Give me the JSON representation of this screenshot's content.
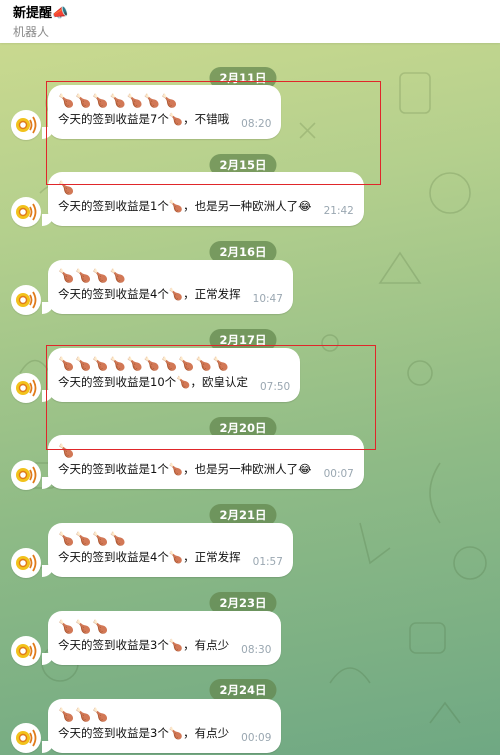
{
  "header": {
    "title": "新提醒📣",
    "subtitle": "机器人"
  },
  "colors": {
    "accent_red": "#e0262a",
    "date_pill": "#62874e",
    "bubble": "#ffffff"
  },
  "avatar_icon": "radar-signal-icon",
  "messages": [
    {
      "date": "2月11日",
      "legs": "🍗🍗🍗🍗🍗🍗🍗",
      "text": "今天的签到收益是7个🍗，不错哦",
      "time": "08:20"
    },
    {
      "date": "2月15日",
      "legs": "🍗",
      "text": "今天的签到收益是1个🍗，也是另一种欧洲人了😂",
      "time": "21:42"
    },
    {
      "date": "2月16日",
      "legs": "🍗🍗🍗🍗",
      "text": "今天的签到收益是4个🍗，正常发挥",
      "time": "10:47"
    },
    {
      "date": "2月17日",
      "legs": "🍗🍗🍗🍗🍗🍗🍗🍗🍗🍗",
      "text": "今天的签到收益是10个🍗，欧皇认定",
      "time": "07:50"
    },
    {
      "date": "2月20日",
      "legs": "🍗",
      "text": "今天的签到收益是1个🍗，也是另一种欧洲人了😂",
      "time": "00:07"
    },
    {
      "date": "2月21日",
      "legs": "🍗🍗🍗🍗",
      "text": "今天的签到收益是4个🍗，正常发挥",
      "time": "01:57"
    },
    {
      "date": "2月23日",
      "legs": "🍗🍗🍗",
      "text": "今天的签到收益是3个🍗，有点少",
      "time": "08:30"
    },
    {
      "date": "2月24日",
      "legs": "🍗🍗🍗",
      "text": "今天的签到收益是3个🍗，有点少",
      "time": "00:09"
    }
  ]
}
